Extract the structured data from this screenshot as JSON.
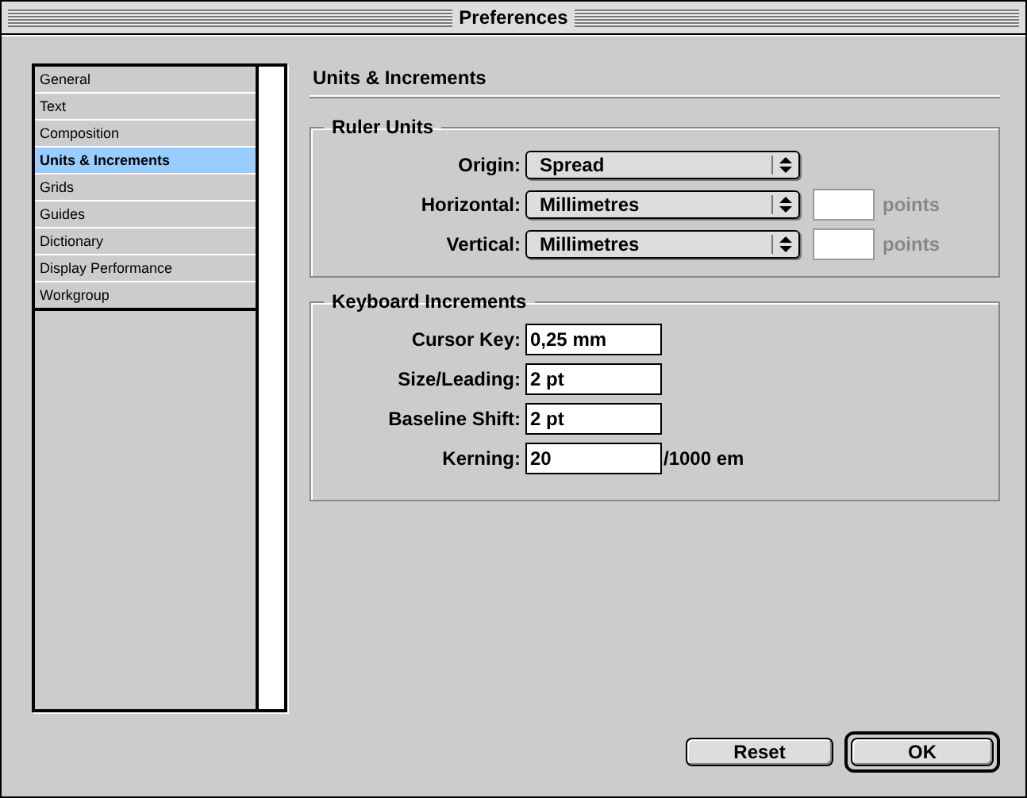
{
  "window": {
    "title": "Preferences"
  },
  "sidebar": {
    "items": [
      {
        "label": "General",
        "selected": false
      },
      {
        "label": "Text",
        "selected": false
      },
      {
        "label": "Composition",
        "selected": false
      },
      {
        "label": "Units & Increments",
        "selected": true
      },
      {
        "label": "Grids",
        "selected": false
      },
      {
        "label": "Guides",
        "selected": false
      },
      {
        "label": "Dictionary",
        "selected": false
      },
      {
        "label": "Display Performance",
        "selected": false
      },
      {
        "label": "Workgroup",
        "selected": false
      }
    ]
  },
  "heading": "Units & Increments",
  "ruler_units": {
    "title": "Ruler Units",
    "rows": [
      {
        "label": "Origin:",
        "value": "Spread"
      },
      {
        "label": "Horizontal:",
        "value": "Millimetres",
        "unit_field": {
          "disabled": true
        },
        "unit": "points"
      },
      {
        "label": "Vertical:",
        "value": "Millimetres",
        "unit_field": {
          "disabled": true
        },
        "unit": "points"
      }
    ]
  },
  "keyboard_increments": {
    "title": "Keyboard Increments",
    "rows": [
      {
        "label": "Cursor Key:",
        "value": "0,25 mm"
      },
      {
        "label": "Size/Leading:",
        "value": "2 pt"
      },
      {
        "label": "Baseline Shift:",
        "value": "2 pt"
      },
      {
        "label": "Kerning:",
        "value": "20",
        "suffix": "/1000 em"
      }
    ]
  },
  "buttons": [
    {
      "label": "Reset",
      "default": false
    },
    {
      "label": "OK",
      "default": true
    }
  ]
}
